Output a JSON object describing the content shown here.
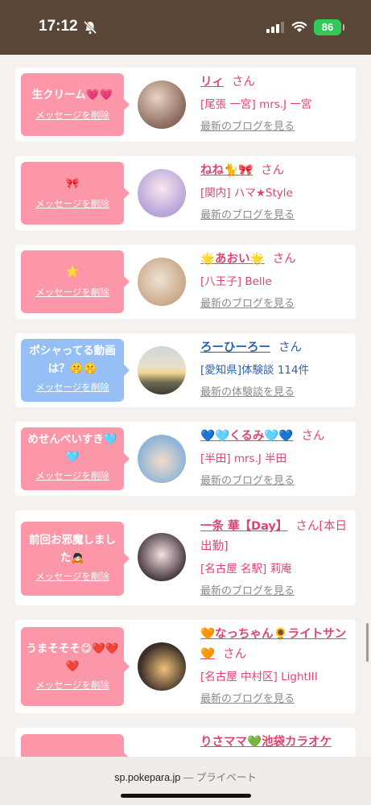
{
  "status": {
    "time": "17:12",
    "battery": "86",
    "icons": [
      "bell-mute-icon",
      "signal-icon",
      "wifi-icon",
      "battery-icon"
    ]
  },
  "colors": {
    "pink_bubble": "#fb97a8",
    "blue_bubble": "#96bff5",
    "name_pink": "#e0456f",
    "name_blue": "#2b63b0",
    "status_bar": "#5a4637"
  },
  "cards": [
    {
      "message": "生クリーム💗💗",
      "delete_label": "メッセージを削除",
      "name": "リィ",
      "honorific": "さん",
      "subtitle": "[尾張 一宮] mrs.J 一宮",
      "link": "最新のブログを見る"
    },
    {
      "message": "🎀",
      "delete_label": "メッセージを削除",
      "name": "ねね🐈🎀",
      "honorific": "さん",
      "subtitle": "[関内] ハマ★Style",
      "link": "最新のブログを見る"
    },
    {
      "message": "🌟",
      "delete_label": "メッセージを削除",
      "name": "🌟あおい🌟",
      "honorific": "さん",
      "subtitle": "[八王子] Belle",
      "link": "最新のブログを見る"
    },
    {
      "message": "ポシャってる動画は？🤫🤫",
      "delete_label": "メッセージを削除",
      "name": "ろーひーろー",
      "honorific": "さん",
      "subtitle": "[愛知県]体験談 114件",
      "link": "最新の体験談を見る"
    },
    {
      "message": "めせんべいすき🩵🩵",
      "delete_label": "メッセージを削除",
      "name": "💙🩵くるみ🩵💙",
      "honorific": "さん",
      "subtitle": "[半田] mrs.J 半田",
      "link": "最新のブログを見る"
    },
    {
      "message": "前回お邪魔しました🙇🏻",
      "delete_label": "メッセージを削除",
      "name": "一条 華【Day】",
      "honorific": "さん[本日出勤]",
      "subtitle": "[名古屋 名駅] 莉庵",
      "link": "最新のブログを見る"
    },
    {
      "message": "うまそそそ😋❤️❤️❤️",
      "delete_label": "メッセージを削除",
      "name": "🧡なっちゃん🌻ライトサン🧡",
      "honorific": "さん",
      "subtitle": "[名古屋 中村区] LightIII",
      "link": "最新のブログを見る"
    },
    {
      "message": "",
      "delete_label": "",
      "name": "りさママ💚池袋カラオケ",
      "honorific": "",
      "subtitle": "",
      "link": ""
    }
  ],
  "browser": {
    "domain": "sp.pokepara.jp",
    "separator": " — ",
    "mode": "プライベート"
  }
}
